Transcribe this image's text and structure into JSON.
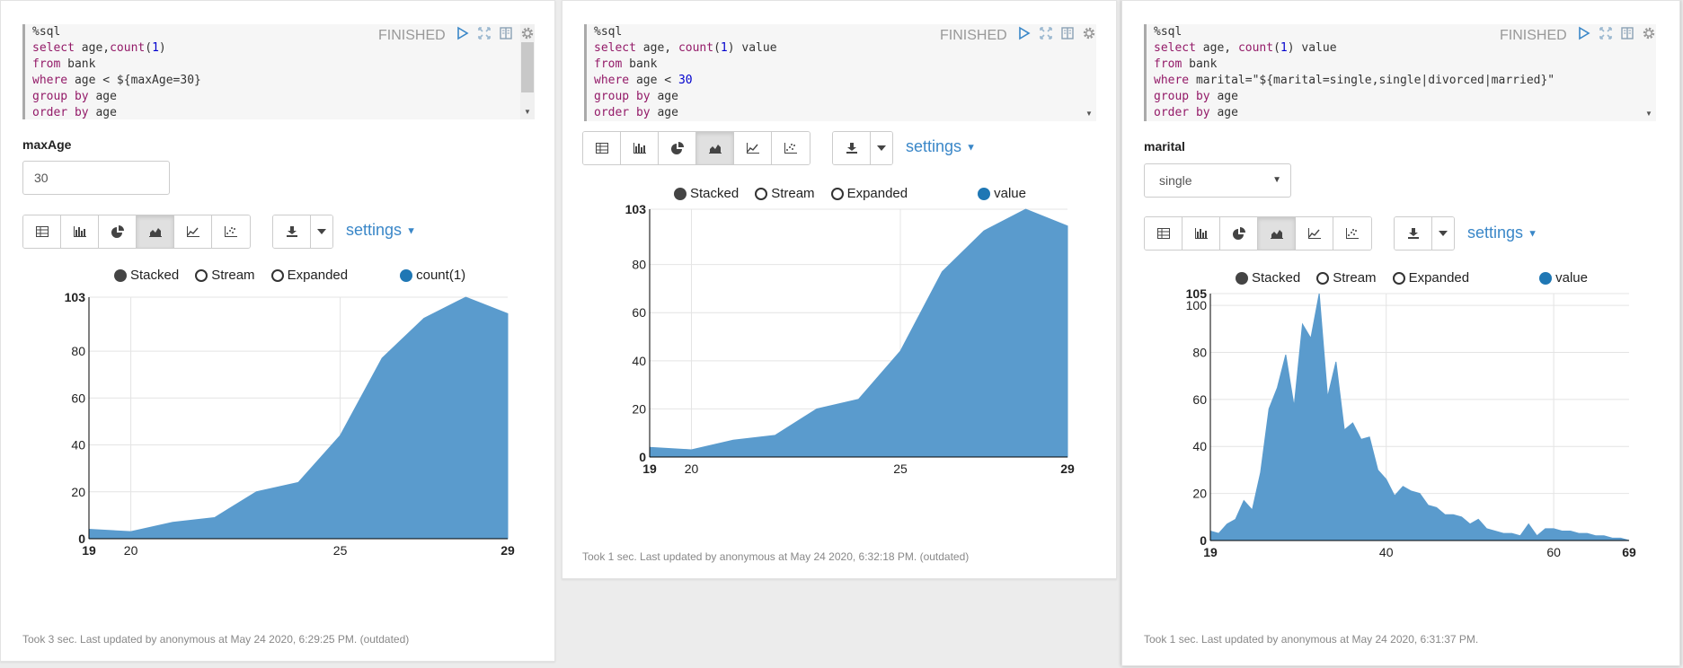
{
  "paragraphs": [
    {
      "code_lines": [
        [
          [
            "%sql",
            "t"
          ]
        ],
        [
          [
            "select",
            "kw"
          ],
          [
            " age,",
            "t"
          ],
          [
            "count",
            "kw"
          ],
          [
            "(",
            "t"
          ],
          [
            "1",
            "num"
          ],
          [
            ")",
            "t"
          ]
        ],
        [
          [
            "from",
            "kw"
          ],
          [
            " bank",
            "t"
          ]
        ],
        [
          [
            "where",
            "kw"
          ],
          [
            " age < ${maxAge=30}",
            "t"
          ]
        ],
        [
          [
            "group by",
            "kw"
          ],
          [
            " age",
            "t"
          ]
        ],
        [
          [
            "order by",
            "kw"
          ],
          [
            " age",
            "t"
          ]
        ]
      ],
      "status": "FINISHED",
      "param": {
        "label": "maxAge",
        "value": "30",
        "type": "input"
      },
      "settings_label": "settings",
      "legend": {
        "stacked": "Stacked",
        "stream": "Stream",
        "expanded": "Expanded",
        "series": "count(1)"
      },
      "footer": "Took 3 sec. Last updated by anonymous at May 24 2020, 6:29:25 PM. (outdated)",
      "chart_data": {
        "type": "area",
        "x": [
          19,
          20,
          21,
          22,
          23,
          24,
          25,
          26,
          27,
          28,
          29
        ],
        "values": [
          4,
          3,
          7,
          9,
          20,
          24,
          44,
          77,
          94,
          103,
          96
        ],
        "series": [
          {
            "name": "count(1)"
          }
        ],
        "xlim": [
          19,
          29
        ],
        "ylim": [
          0,
          103
        ],
        "xticks": [
          19,
          20,
          25,
          29
        ],
        "yticks": [
          0,
          20,
          40,
          60,
          80,
          103
        ],
        "grid": true,
        "color": "#5a9bcd"
      }
    },
    {
      "code_lines": [
        [
          [
            "%sql",
            "t"
          ]
        ],
        [
          [
            "select",
            "kw"
          ],
          [
            " age, ",
            "t"
          ],
          [
            "count",
            "kw"
          ],
          [
            "(",
            "t"
          ],
          [
            "1",
            "num"
          ],
          [
            ") value",
            "t"
          ]
        ],
        [
          [
            "from",
            "kw"
          ],
          [
            " bank",
            "t"
          ]
        ],
        [
          [
            "where",
            "kw"
          ],
          [
            " age < ",
            "t"
          ],
          [
            "30",
            "num"
          ]
        ],
        [
          [
            "group by",
            "kw"
          ],
          [
            " age",
            "t"
          ]
        ],
        [
          [
            "order by",
            "kw"
          ],
          [
            " age",
            "t"
          ]
        ]
      ],
      "status": "FINISHED",
      "settings_label": "settings",
      "legend": {
        "stacked": "Stacked",
        "stream": "Stream",
        "expanded": "Expanded",
        "series": "value"
      },
      "footer": "Took 1 sec. Last updated by anonymous at May 24 2020, 6:32:18 PM. (outdated)",
      "chart_data": {
        "type": "area",
        "x": [
          19,
          20,
          21,
          22,
          23,
          24,
          25,
          26,
          27,
          28,
          29
        ],
        "values": [
          4,
          3,
          7,
          9,
          20,
          24,
          44,
          77,
          94,
          103,
          96
        ],
        "series": [
          {
            "name": "value"
          }
        ],
        "xlim": [
          19,
          29
        ],
        "ylim": [
          0,
          103
        ],
        "xticks": [
          19,
          20,
          25,
          29
        ],
        "yticks": [
          0,
          20,
          40,
          60,
          80,
          103
        ],
        "grid": true,
        "color": "#5a9bcd"
      }
    },
    {
      "code_lines": [
        [
          [
            "%sql",
            "t"
          ]
        ],
        [
          [
            "select",
            "kw"
          ],
          [
            " age, ",
            "t"
          ],
          [
            "count",
            "kw"
          ],
          [
            "(",
            "t"
          ],
          [
            "1",
            "num"
          ],
          [
            ") value",
            "t"
          ]
        ],
        [
          [
            "from",
            "kw"
          ],
          [
            " bank",
            "t"
          ]
        ],
        [
          [
            "where",
            "kw"
          ],
          [
            " marital=\"${marital=single,single|divorced|married}\"",
            "t"
          ]
        ],
        [
          [
            "group by",
            "kw"
          ],
          [
            " age",
            "t"
          ]
        ],
        [
          [
            "order by",
            "kw"
          ],
          [
            " age",
            "t"
          ]
        ]
      ],
      "status": "FINISHED",
      "param": {
        "label": "marital",
        "value": "single",
        "type": "select"
      },
      "settings_label": "settings",
      "legend": {
        "stacked": "Stacked",
        "stream": "Stream",
        "expanded": "Expanded",
        "series": "value"
      },
      "footer": "Took 1 sec. Last updated by anonymous at May 24 2020, 6:31:37 PM.",
      "chart_data": {
        "type": "area",
        "x": [
          19,
          20,
          21,
          22,
          23,
          24,
          25,
          26,
          27,
          28,
          29,
          30,
          31,
          32,
          33,
          34,
          35,
          36,
          37,
          38,
          39,
          40,
          41,
          42,
          43,
          44,
          45,
          46,
          47,
          48,
          49,
          50,
          51,
          52,
          53,
          54,
          55,
          56,
          57,
          58,
          59,
          60,
          61,
          62,
          63,
          64,
          65,
          66,
          67,
          68,
          69
        ],
        "values": [
          4,
          3,
          7,
          9,
          17,
          13,
          29,
          56,
          65,
          79,
          57,
          92,
          86,
          105,
          61,
          76,
          47,
          50,
          43,
          44,
          30,
          26,
          19,
          23,
          21,
          20,
          15,
          14,
          11,
          11,
          10,
          7,
          9,
          5,
          4,
          3,
          3,
          2,
          7,
          2,
          5,
          5,
          4,
          4,
          3,
          3,
          2,
          2,
          1,
          1,
          0
        ],
        "series": [
          {
            "name": "value"
          }
        ],
        "xlim": [
          19,
          69
        ],
        "ylim": [
          0,
          105
        ],
        "xticks": [
          19,
          40,
          60,
          69
        ],
        "yticks": [
          0,
          20,
          40,
          60,
          80,
          100,
          105
        ],
        "grid": true,
        "color": "#5a9bcd"
      }
    }
  ]
}
